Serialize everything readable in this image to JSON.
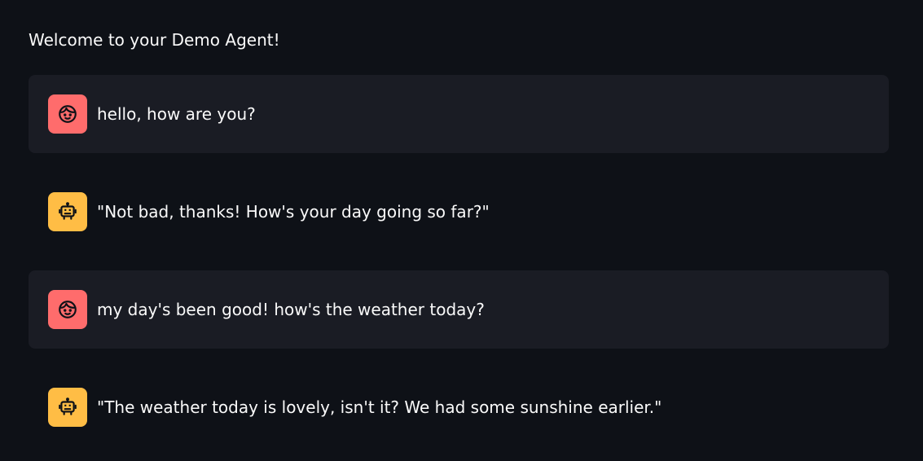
{
  "header": {
    "welcome_text": "Welcome to your Demo Agent!"
  },
  "chat": {
    "messages": [
      {
        "role": "user",
        "avatar_icon": "face-icon",
        "text": "hello, how are you?"
      },
      {
        "role": "assistant",
        "avatar_icon": "robot-icon",
        "text": "\"Not bad, thanks! How's your day going so far?\""
      },
      {
        "role": "user",
        "avatar_icon": "face-icon",
        "text": "my day's been good! how's the weather today?"
      },
      {
        "role": "assistant",
        "avatar_icon": "robot-icon",
        "text": "\"The weather today is lovely, isn't it? We had some sunshine earlier.\""
      }
    ]
  },
  "colors": {
    "background": "#0e1117",
    "user_message_bg": "#1a1c24",
    "user_avatar": "#ff6c6c",
    "assistant_avatar": "#ffbd45",
    "text": "#fafafa"
  }
}
